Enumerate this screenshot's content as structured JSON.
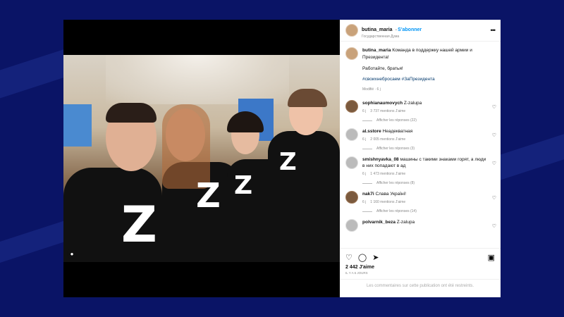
{
  "post": {
    "username": "butina_maria",
    "follow_label": "S'abonner",
    "subtitle": "Государственная Дума",
    "caption_user": "butina_maria",
    "caption_text": "Команда в поддержку нашей армии и Президента!",
    "caption_line2": "Работайте, братья!",
    "hashtags": "#своихнебросаем #ЗаПрезидента",
    "modified": "Modifié · 6 j",
    "likes": "2 442 J'aime",
    "time_ago": "IL Y A 6 JOURS",
    "comments_closed": "Les commentaires sur cette publication ont été restreints.",
    "shirt_letter": "Z"
  },
  "comments": [
    {
      "user": "sophianaumovych",
      "text": "Z-zalupa",
      "age": "6 j",
      "likes": "3 737 mentions J'aime",
      "replies": "Afficher les réponses (22)",
      "avatar": "brown"
    },
    {
      "user": "al.sstore",
      "text": "Неадекватная",
      "age": "6 j",
      "likes": "2 005 mentions J'aime",
      "replies": "Afficher les réponses (3)",
      "avatar": "gray"
    },
    {
      "user": "smishnyavka_08",
      "text": "машины с такими знаками горят, а люди в них попадают в ад",
      "age": "6 j",
      "likes": "1 473 mentions J'aime",
      "replies": "Afficher les réponses (8)",
      "avatar": "gray"
    },
    {
      "user": "nak7i",
      "text": "Слава Україні!",
      "age": "6 j",
      "likes": "1 160 mentions J'aime",
      "replies": "Afficher les réponses (14)",
      "avatar": "brown"
    },
    {
      "user": "polvarnik_beza",
      "text": "Z-zalupa",
      "age": "",
      "likes": "",
      "replies": "",
      "avatar": "gray"
    }
  ]
}
